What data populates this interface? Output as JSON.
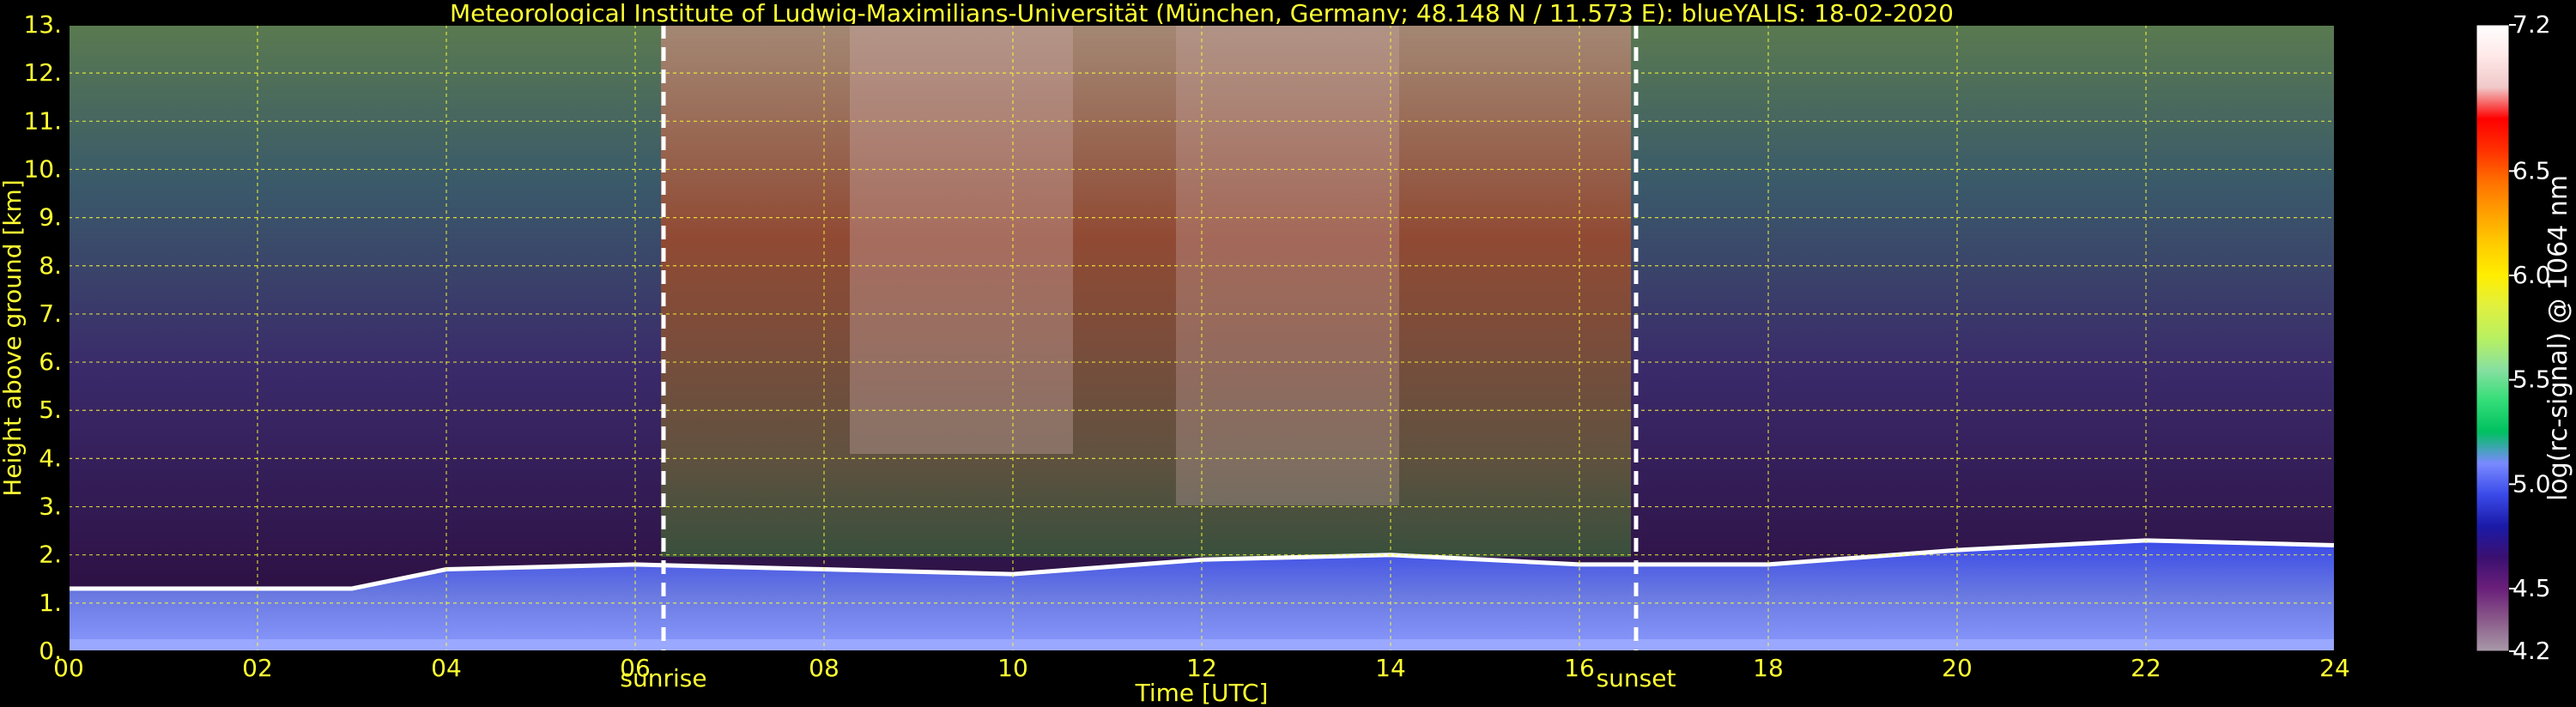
{
  "chart_data": {
    "type": "heatmap",
    "title": "Meteorological Institute of Ludwig-Maximilians-Universität (München, Germany; 48.148 N / 11.573 E):     blueYALIS: 18-02-2020",
    "xlabel": "Time [UTC]",
    "ylabel": "Height above ground [km]",
    "xlim": [
      0,
      24
    ],
    "ylim": [
      0,
      13
    ],
    "x_ticks": [
      "00",
      "02",
      "04",
      "06",
      "08",
      "10",
      "12",
      "14",
      "16",
      "18",
      "20",
      "22",
      "24"
    ],
    "y_ticks": [
      "0.",
      "1.",
      "2.",
      "3.",
      "4.",
      "5.",
      "6.",
      "7.",
      "8.",
      "9.",
      "10.",
      "11.",
      "12.",
      "13."
    ],
    "grid": true,
    "events": [
      {
        "label": "sunrise",
        "time_utc": 6.3
      },
      {
        "label": "sunset",
        "time_utc": 16.6
      }
    ],
    "colorbar": {
      "label": "log(rc-signal) @ 1064 nm",
      "range": [
        4.2,
        7.2
      ],
      "ticks": [
        "4.2",
        "4.5",
        "5.0",
        "5.5",
        "6.0",
        "6.5",
        "7.2"
      ],
      "colors": [
        "#a89aa8",
        "#8a5a8a",
        "#6a1f7a",
        "#3a1070",
        "#1a1aa8",
        "#3a4ae8",
        "#7a8aff",
        "#00c060",
        "#33dd77",
        "#88e0a0",
        "#b8f060",
        "#e0f040",
        "#ffee00",
        "#ffcc00",
        "#ffa000",
        "#ff7000",
        "#ff3000",
        "#ff0000",
        "#f0c8c8",
        "#ffe8e8",
        "#ffffff"
      ]
    },
    "boundary_layer_top_km": [
      {
        "time": 0,
        "km": 1.3
      },
      {
        "time": 3,
        "km": 1.3
      },
      {
        "time": 4,
        "km": 1.7
      },
      {
        "time": 6,
        "km": 1.8
      },
      {
        "time": 8,
        "km": 1.7
      },
      {
        "time": 10,
        "km": 1.6
      },
      {
        "time": 12,
        "km": 1.9
      },
      {
        "time": 14,
        "km": 2.0
      },
      {
        "time": 16,
        "km": 1.8
      },
      {
        "time": 18,
        "km": 1.8
      },
      {
        "time": 20,
        "km": 2.1
      },
      {
        "time": 22,
        "km": 2.3
      },
      {
        "time": 24,
        "km": 2.2
      }
    ]
  }
}
